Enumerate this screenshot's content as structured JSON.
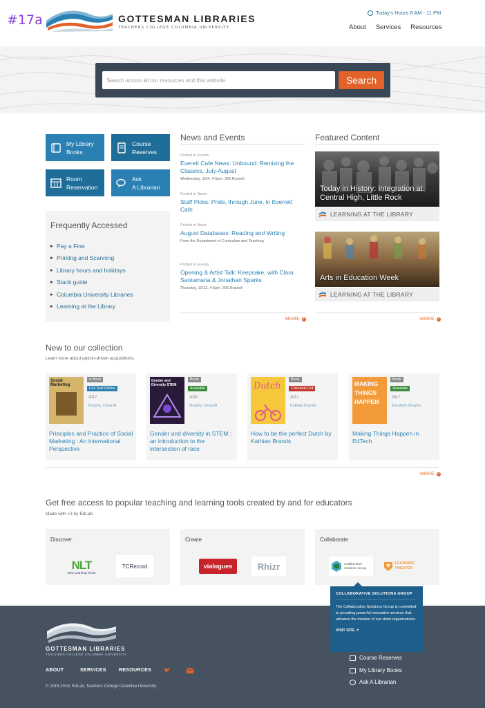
{
  "corner_label": "#17a",
  "brand": {
    "name": "GOTTESMAN LIBRARIES",
    "sub": "TEACHERS COLLEGE  COLUMBIA UNIVERSITY"
  },
  "hours": "Today's Hours 8 AM - 11 PM",
  "nav": [
    "About",
    "Services",
    "Resources"
  ],
  "search": {
    "placeholder": "Search across all our resources and this website",
    "button": "Search"
  },
  "quick_links": {
    "books": [
      "My Library",
      "Books"
    ],
    "reserves": [
      "Course",
      "Reserves"
    ],
    "room": [
      "Room",
      "Reservation"
    ],
    "ask": [
      "Ask",
      "A Librarian"
    ]
  },
  "frequently": {
    "title": "Frequently Accessed",
    "items": [
      "Pay a Fine",
      "Printing and Scanning",
      "Library hours and holidays",
      "Stack guide",
      "Columbia University Libraries",
      "Learning at the Library"
    ]
  },
  "news": {
    "title": "News and Events",
    "items": [
      {
        "posted": "Posted in Events",
        "title": "Everett Cafe News: Unbound: Remixing the Classics, July-August",
        "meta": "Wednesday, 10/4, 4-5pm, 305 Russell"
      },
      {
        "posted": "Posted in News",
        "title": "Staff Picks: Pride, through June, in Everrett Cafe",
        "meta": ""
      },
      {
        "posted": "Posted in News",
        "title": "August Databases: Reading and Writing",
        "meta": "From the Department of Curriculum and Teaching"
      },
      {
        "posted": "Posted in Events",
        "title": "Opening & Artist Talk: Keepsake, with Clara Santamaria & Jonathan Sparks",
        "meta": "Thursday, 10/12, 4-5pm, 306 Russell"
      }
    ],
    "more": "MORE"
  },
  "featured": {
    "title": "Featured Content",
    "items": [
      {
        "caption": "Today in History: Integration at Central High, Little Rock",
        "tag": "LEARNING AT THE LIBRARY"
      },
      {
        "caption": "Arts in Education Week",
        "tag": "LEARNING AT THE LIBRARY"
      }
    ],
    "more": "MORE"
  },
  "collection": {
    "title": "New to our collection",
    "subtitle": "Learn more about patron-driven acquisitions.",
    "more": "MORE",
    "items": [
      {
        "type": "e-Book",
        "status": "Full Text Online",
        "status_color": "#2a80b3",
        "year": "2017",
        "author": "Murphy, Dena M.",
        "title": "Principles and Practice of Social Marketing : An International Perspective",
        "cover_text": "Social Marketing"
      },
      {
        "type": "Book",
        "status": "Available",
        "status_color": "#3a8a3a",
        "year": "2016",
        "author": "Murphy, Dena M.",
        "title": "Gender and diversity in STEM : an introduction to the intersection of race",
        "cover_text": "Gender and Diversity STEM"
      },
      {
        "type": "Book",
        "status": "Checked-Out",
        "status_color": "#c0392b",
        "year": "2017",
        "author": "Kathian Brands",
        "title": "How to be the perfect Dutch by Kathian Brands",
        "cover_text": "Dutch"
      },
      {
        "type": "Book",
        "status": "Available",
        "status_color": "#3a8a3a",
        "year": "2017",
        "author": "Elizabeth Murphy",
        "title": "Making Things Happen in EdTech",
        "cover_text": "MAKING THINGS HAPPEN"
      }
    ]
  },
  "tools": {
    "title": "Get free access to popular teaching and learning tools created by and for educators",
    "subtitle": "Made with <3 by EdLab.",
    "groups": [
      {
        "label": "Discover",
        "logos": [
          "NLT",
          "New Learning Times",
          "TCRecord"
        ]
      },
      {
        "label": "Create",
        "logos": [
          "vialogues",
          "Rhizr"
        ]
      },
      {
        "label": "Collaborate",
        "logos": [
          "Collaborative Solutions Group",
          "LEARNING THEATER"
        ]
      }
    ]
  },
  "popup": {
    "title": "COLLABORATIVE SOLUTIONS GROUP",
    "body": "The Collaborative Solutions Group is committed to providing powerful innovative services that advance the mission of our client organizations.",
    "link": "VISIT SITE"
  },
  "footer": {
    "brand": "GOTTESMAN LIBRARIES",
    "sub": "TEACHERS COLLEGE  COLUMBIA UNIVERSITY",
    "nav": [
      "ABOUT",
      "SERVICES",
      "RESOURCES"
    ],
    "links": [
      "Course Reserves",
      "My Library Books",
      "Ask A Librarian"
    ],
    "copyright": "© 2015-2016, EdLab, Teachers College Columbia University"
  },
  "colors": {
    "accent": "#e2622a",
    "primary": "#2a80b3",
    "footer": "#465260"
  }
}
